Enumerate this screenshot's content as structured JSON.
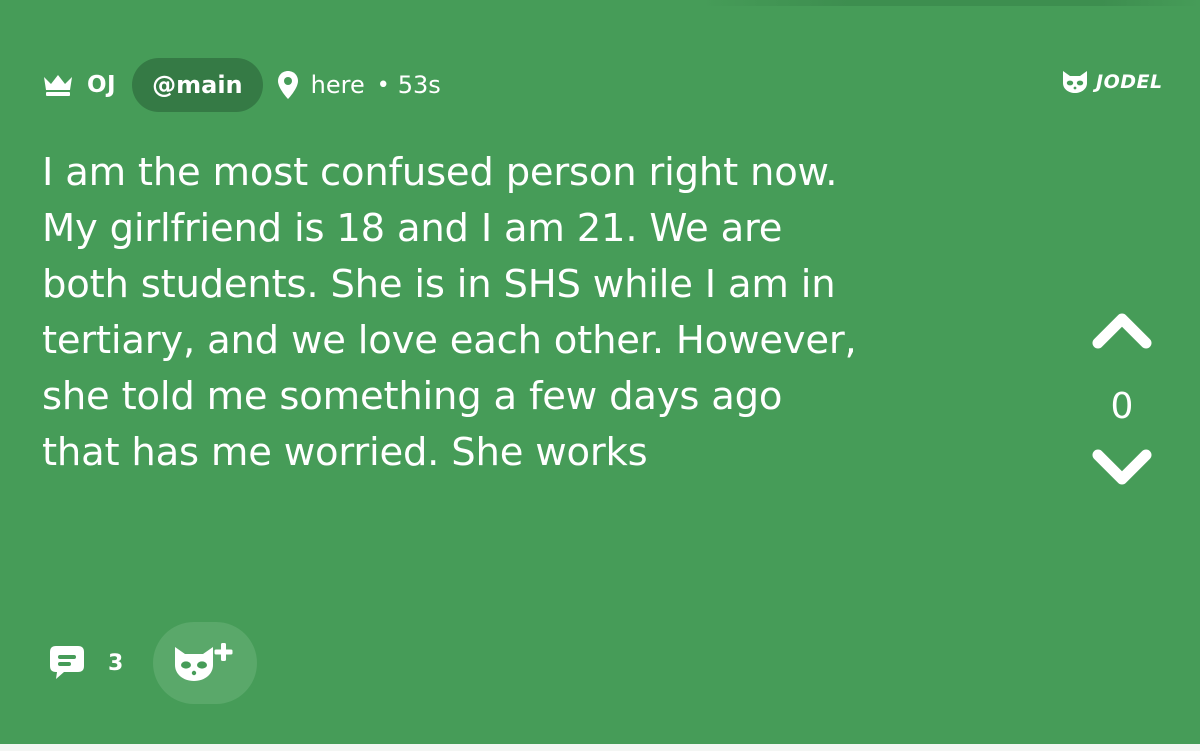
{
  "post": {
    "author": "OJ",
    "channel": "@main",
    "location": "here",
    "separator": "•",
    "age": "53s",
    "text": "I am the most confused person right now.\nMy girlfriend is 18 and I am 21. We are\nboth students. She is in SHS while I am in\ntertiary, and we love each other. However,\nshe told me something a few days ago\nthat has me worried. She works"
  },
  "brand": {
    "name": "JODEL"
  },
  "vote": {
    "score": "0"
  },
  "footer": {
    "comment_count": "3"
  },
  "icons": {
    "crown": "crown-icon",
    "pin": "location-pin-icon",
    "brand": "jodel-mascot-icon",
    "upvote": "chevron-up-icon",
    "downvote": "chevron-down-icon",
    "comment": "comment-bubble-icon",
    "mascot_add": "mascot-plus-icon"
  },
  "colors": {
    "card_background": "#469c58",
    "channel_pill": "#357a45",
    "mascot_button": "#5aa86a",
    "text": "#ffffff"
  }
}
